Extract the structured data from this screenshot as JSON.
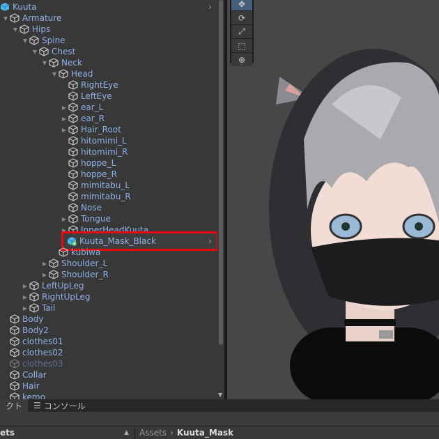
{
  "hierarchy": {
    "items": [
      {
        "label": "Kuuta",
        "depth": 0,
        "arrow": "none",
        "icon": "prefab",
        "chevron": true,
        "root": true
      },
      {
        "label": "Armature",
        "depth": 0,
        "arrow": "down"
      },
      {
        "label": "Hips",
        "depth": 1,
        "arrow": "down"
      },
      {
        "label": "Spine",
        "depth": 2,
        "arrow": "down"
      },
      {
        "label": "Chest",
        "depth": 3,
        "arrow": "down"
      },
      {
        "label": "Neck",
        "depth": 4,
        "arrow": "down"
      },
      {
        "label": "Head",
        "depth": 5,
        "arrow": "down"
      },
      {
        "label": "RightEye",
        "depth": 6,
        "arrow": "none"
      },
      {
        "label": "LeftEye",
        "depth": 6,
        "arrow": "none"
      },
      {
        "label": "ear_L",
        "depth": 6,
        "arrow": "right"
      },
      {
        "label": "ear_R",
        "depth": 6,
        "arrow": "right"
      },
      {
        "label": "Hair_Root",
        "depth": 6,
        "arrow": "right"
      },
      {
        "label": "hitomimi_L",
        "depth": 6,
        "arrow": "none"
      },
      {
        "label": "hitomimi_R",
        "depth": 6,
        "arrow": "none"
      },
      {
        "label": "hoppe_L",
        "depth": 6,
        "arrow": "none"
      },
      {
        "label": "hoppe_R",
        "depth": 6,
        "arrow": "none"
      },
      {
        "label": "mimitabu_L",
        "depth": 6,
        "arrow": "none"
      },
      {
        "label": "mimitabu_R",
        "depth": 6,
        "arrow": "none"
      },
      {
        "label": "Nose",
        "depth": 6,
        "arrow": "none"
      },
      {
        "label": "Tongue",
        "depth": 6,
        "arrow": "right"
      },
      {
        "label": "InnerHeadKuuta",
        "depth": 6,
        "arrow": "right"
      },
      {
        "label": "Kuuta_Mask_Black",
        "depth": 6,
        "arrow": "none",
        "icon": "prefab-added",
        "chevron": true,
        "selected": true
      },
      {
        "label": "kubiwa",
        "depth": 5,
        "arrow": "none"
      },
      {
        "label": "Shoulder_L",
        "depth": 4,
        "arrow": "right"
      },
      {
        "label": "Shoulder_R",
        "depth": 4,
        "arrow": "right"
      },
      {
        "label": "LeftUpLeg",
        "depth": 2,
        "arrow": "right"
      },
      {
        "label": "RightUpLeg",
        "depth": 2,
        "arrow": "right"
      },
      {
        "label": "Tail",
        "depth": 2,
        "arrow": "right"
      },
      {
        "label": "Body",
        "depth": 0,
        "arrow": "none"
      },
      {
        "label": "Body2",
        "depth": 0,
        "arrow": "none"
      },
      {
        "label": "clothes01",
        "depth": 0,
        "arrow": "none"
      },
      {
        "label": "clothes02",
        "depth": 0,
        "arrow": "none"
      },
      {
        "label": "clothes03",
        "depth": 0,
        "arrow": "none",
        "disabled": true
      },
      {
        "label": "Collar",
        "depth": 0,
        "arrow": "none"
      },
      {
        "label": "Hair",
        "depth": 0,
        "arrow": "none"
      },
      {
        "label": "kemo",
        "depth": 0,
        "arrow": "none"
      }
    ]
  },
  "scene_tools": [
    "move-tool",
    "rotate-tool",
    "scale-tool",
    "rect-tool",
    "transform-tool"
  ],
  "bottom_tabs": [
    {
      "label": "クト",
      "active": true
    },
    {
      "label": "コンソール",
      "icon": "console-icon"
    }
  ],
  "project": {
    "left_label": "ets",
    "breadcrumb": [
      "Assets",
      "Kuuta_Mask"
    ]
  },
  "colors": {
    "highlight": "#e50914",
    "label": "#8fb0e6"
  }
}
